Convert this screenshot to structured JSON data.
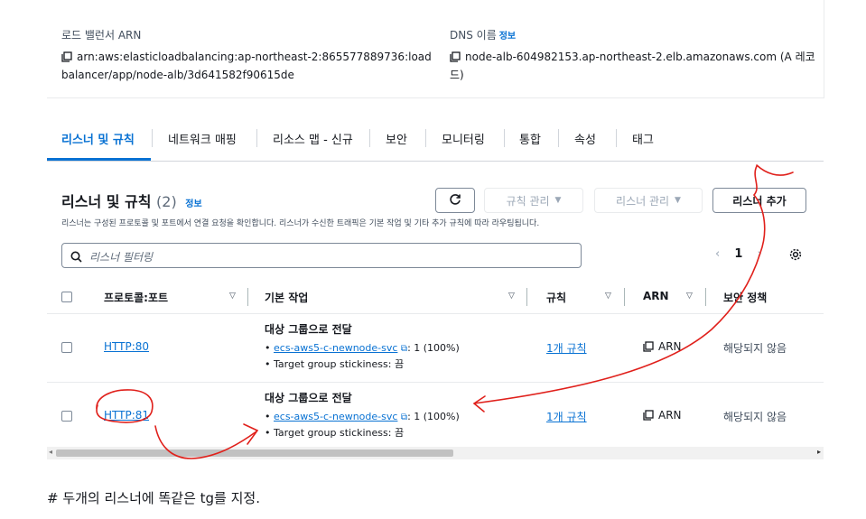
{
  "details": {
    "arn_label": "로드 밸런서 ARN",
    "arn_line1": "arn:aws:elasticloadbalancing:ap-northeast-2:865577889736:load",
    "arn_line2": "balancer/app/node-alb/3d641582f90615de",
    "dns_label": "DNS 이름",
    "dns_info": "정보",
    "dns_line1": "node-alb-604982153.ap-northeast-2.elb.amazonaws.com (A 레코",
    "dns_line2": "드)"
  },
  "tabs": [
    "리스너 및 규칙",
    "네트워크 매핑",
    "리소스 맵 - 신규",
    "보안",
    "모니터링",
    "통합",
    "속성",
    "태그"
  ],
  "panel": {
    "title": "리스너 및 규칙",
    "count": "(2)",
    "info": "정보",
    "description": "리스너는 구성된 프로토콜 및 포트에서 연결 요청을 확인합니다. 리스너가 수신한 트래픽은 기본 작업 및 기타 추가 규칙에 따라 라우팅됩니다.",
    "manage_rules": "규칙 관리",
    "manage_listener": "리스너 관리",
    "add_listener": "리스너 추가",
    "search_placeholder": "리스너 필터링",
    "page_number": "1"
  },
  "columns": [
    "프로토콜:포트",
    "기본 작업",
    "규칙",
    "ARN",
    "보안 정책"
  ],
  "rows": [
    {
      "protocol": "HTTP:80",
      "action_title": "대상 그룹으로 전달",
      "tg_link": "ecs-aws5-c-newnode-svc",
      "tg_weight": ": 1 (100%)",
      "stickiness": "Target group stickiness: 끔",
      "rules": "1개 규칙",
      "arn": "ARN",
      "policy": "해당되지 않음"
    },
    {
      "protocol": "HTTP:81",
      "action_title": "대상 그룹으로 전달",
      "tg_link": "ecs-aws5-c-newnode-svc",
      "tg_weight": ": 1 (100%)",
      "stickiness": "Target group stickiness: 끔",
      "rules": "1개 규칙",
      "arn": "ARN",
      "policy": "해당되지 않음"
    }
  ],
  "caption": "# 두개의 리스너에 똑같은 tg를 지정.",
  "colors": {
    "accent": "#0972d3",
    "annotation": "#e0201b"
  }
}
